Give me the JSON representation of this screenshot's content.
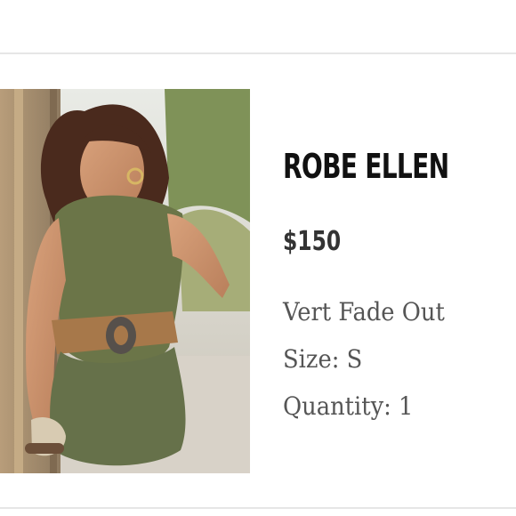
{
  "product": {
    "name": "ROBE ELLEN",
    "price": "$150",
    "variant": "Vert Fade Out",
    "size": "Size: S",
    "quantity": "Quantity: 1",
    "image_description_icon": "product-photo-icon"
  },
  "colors": {
    "title": "#111111",
    "price": "#333333",
    "details": "#555555",
    "divider": "#e6e6e6",
    "dress": "#6b7548",
    "belt": "#a7784a"
  }
}
